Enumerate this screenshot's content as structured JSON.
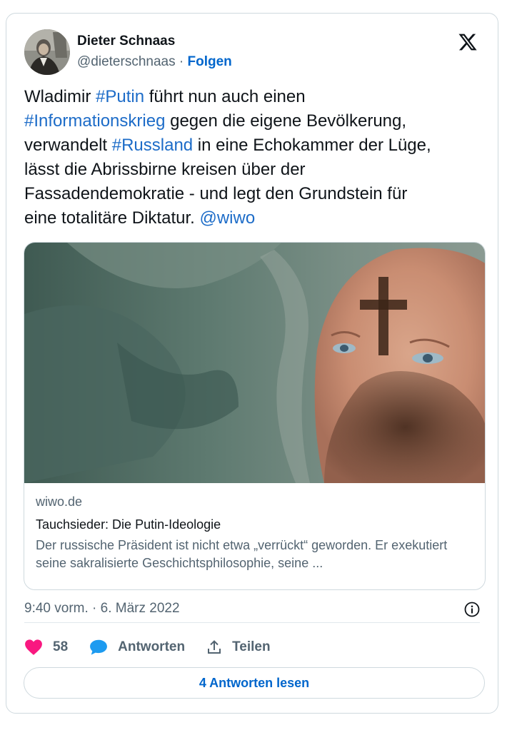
{
  "author": {
    "name": "Dieter Schnaas",
    "handle": "@dieterschnaas",
    "separator": " · ",
    "follow_label": "Folgen"
  },
  "header_icons": {
    "platform_logo": "x-logo-icon"
  },
  "tweet": {
    "text_parts": [
      {
        "type": "text",
        "value": "Wladimir "
      },
      {
        "type": "link",
        "value": "#Putin"
      },
      {
        "type": "text",
        "value": " führt nun auch einen\n"
      },
      {
        "type": "link",
        "value": "#Informationskrieg"
      },
      {
        "type": "text",
        "value": " gegen die eigene Bevölkerung,\nverwandelt "
      },
      {
        "type": "link",
        "value": "#Russland"
      },
      {
        "type": "text",
        "value": " in eine Echokammer der Lüge,\nlässt die Abrissbirne kreisen über der\nFassadendemokratie - und legt den Grundstein für\neine totalitäre Diktatur. "
      },
      {
        "type": "link",
        "value": "@wiwo"
      }
    ]
  },
  "link_card": {
    "domain": "wiwo.de",
    "title": "Tauchsieder: Die Putin-Ideologie",
    "description": "Der russische Präsident ist nicht etwa „verrückt“ geworden. Er exekutiert seine sakralisierte Geschichtsphilosophie, seine ..."
  },
  "meta": {
    "timestamp": "9:40 vorm. · 6. März 2022",
    "info_icon": "info-icon"
  },
  "actions": {
    "like_count": "58",
    "reply_label": "Antworten",
    "share_label": "Teilen"
  },
  "read_replies_label": "4 Antworten lesen",
  "colors": {
    "link": "#1d6cc8",
    "follow": "#0066cc",
    "like_heart": "#f91880",
    "reply_bubble": "#1d9bf0",
    "muted_text": "#536471",
    "border": "#cfd9de"
  }
}
